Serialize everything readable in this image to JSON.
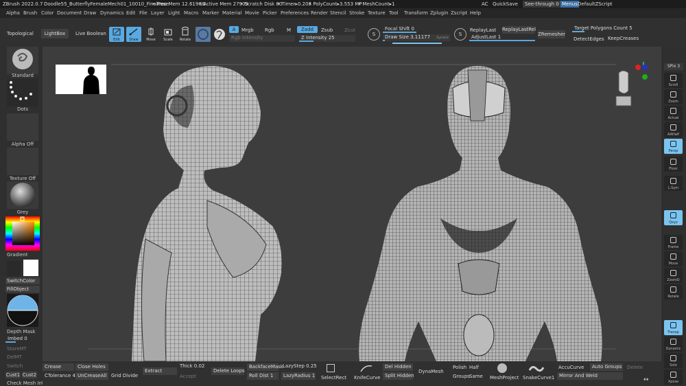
{
  "titlebar": {
    "app": "ZBrush 2022.0.7",
    "document": "Doodle55_ButterflyFemaleMech01_10010_FinalPose",
    "free_mem": "• Free Mem 12.619GB",
    "active_mem": "• Active Mem 27909",
    "scratch": "• Scratch Disk 80",
    "timer": "• Timer▸0.208",
    "polycount": "• PolyCount▸3.553 MP",
    "meshcount": "• MeshCount▸1",
    "ac": "AC",
    "quicksave": "QuickSave",
    "seethrough": "See-through",
    "seethrough_val": "0",
    "menus": "Menus",
    "script": "DefaultZScript"
  },
  "menubar": [
    "Alpha",
    "Brush",
    "Color",
    "Document",
    "Draw",
    "Dynamics",
    "Edit",
    "File",
    "Layer",
    "Light",
    "Macro",
    "Marker",
    "Material",
    "Movie",
    "Picker",
    "Preferences",
    "Render",
    "Stencil",
    "Stroke",
    "Texture",
    "Tool",
    "Transform",
    "Zplugin",
    "Zscript",
    "Help"
  ],
  "toolbar": {
    "topological": "Topological",
    "lightbox": "LightBox",
    "live_boolean": "Live Boolean",
    "edit": "Edit",
    "draw": "Draw",
    "move": "Move",
    "scale": "Scale",
    "rotate": "Rotate",
    "a": "A",
    "mrgb": "Mrgb",
    "rgb": "Rgb",
    "m": "M",
    "zadd": "Zadd",
    "zsub": "Zsub",
    "zcut": "Zcut",
    "rgb_intensity": "Rgb Intensity",
    "z_intensity": "Z Intensity 25",
    "focal_shift": "Focal Shift 0",
    "draw_size": "Draw Size 3.11177",
    "dynamic": "Dynamic",
    "replay_last": "ReplayLast",
    "replay_last_rel": "ReplayLastRel",
    "adjust_last": "AdjustLast 1",
    "zremesher": "ZRemesher",
    "target_polygons": "Target Polygons Count 5",
    "detect_edges": "DetectEdges",
    "keep_creases": "KeepCreases"
  },
  "leftshelf": {
    "standard": "Standard",
    "dots": "Dots",
    "alpha_off": "Alpha Off",
    "texture_off": "Texture Off",
    "grey": "Grey",
    "gradient": "Gradient",
    "switch_color": "SwitchColor",
    "fill_object": "FillObject",
    "depth_mask": "Depth Mask",
    "imbed": "Imbed 0",
    "store_mt": "StoreMT",
    "del_mt": "DelMT",
    "switch": "Switch",
    "cust1": "Cust1",
    "cust2": "Cust2",
    "check_mesh": "Check Mesh Int"
  },
  "rightshelf": {
    "spix": "SPix 3",
    "items": [
      "Scroll",
      "Zoom",
      "Actual",
      "AAHalf",
      "Persp",
      "Floor",
      "L.Sym",
      "",
      "Qxyz",
      "",
      "Frame",
      "Move",
      "ZoomD",
      "Rotate",
      "",
      "Transp",
      "Dynamic",
      "Solo",
      "Xpose"
    ]
  },
  "bottombar": {
    "crease": "Crease",
    "close_holes": "Close Holes",
    "ctolerance": "CTolerance 45",
    "uncrease_all": "UnCreaseAll",
    "grid_divide": "Grid Divide",
    "extract": "Extract",
    "thick": "Thick 0.02",
    "accept": "Accept",
    "delete_loops": "Delete Loops",
    "backface_mask": "BackfaceMask",
    "roll_dist": "Roll Dist 1",
    "lazy_step": "LazyStep 0.25",
    "lazy_radius": "LazyRadius 1",
    "select_rect": "SelectRect",
    "knife_curve": "KnifeCurve",
    "del_hidden": "Del Hidden",
    "split_hidden": "Split Hidden",
    "dynamesh": "DynaMesh",
    "polish": "Polish",
    "half": "Half",
    "groups": "Groups",
    "same": "Same",
    "mesh_project": "MeshProject",
    "snake_curve": "SnakeCurve1",
    "accu_curve": "AccuCurve",
    "auto_groups": "Auto Groups",
    "delete": "Delete",
    "mirror_weld": "Mirror And Weld"
  },
  "colors": {
    "accent": "#5aa9e0",
    "canvas": "#3d3d3d",
    "shelf": "#2f2f2f"
  }
}
